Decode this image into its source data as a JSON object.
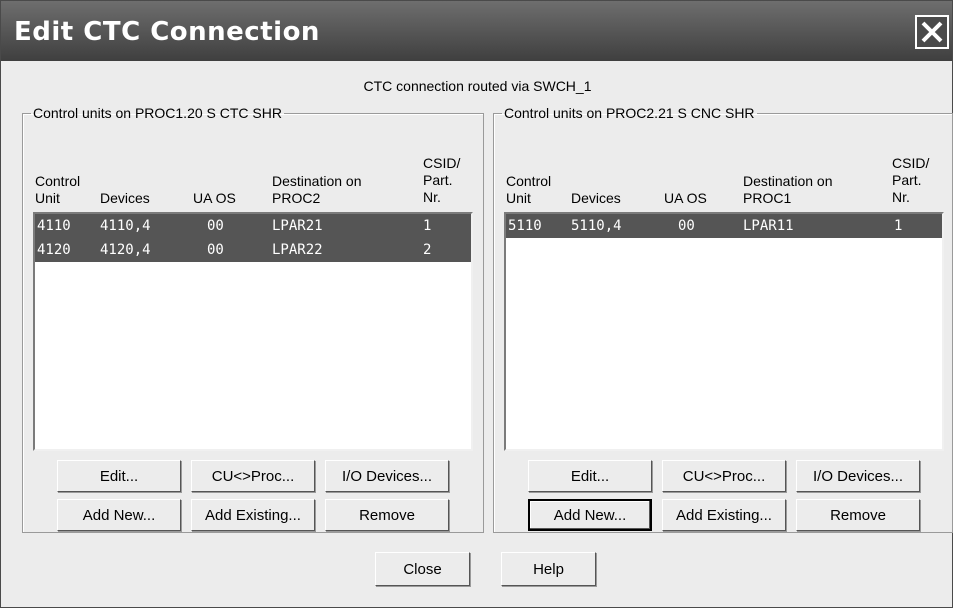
{
  "window": {
    "title": "Edit CTC Connection"
  },
  "route_text": "CTC connection routed via SWCH_1",
  "left_panel": {
    "legend": "Control units on PROC1.20 S CTC SHR",
    "headers": {
      "control_unit": [
        "Control",
        "Unit"
      ],
      "devices": "Devices",
      "ua_os": "UA OS",
      "destination": [
        "Destination on",
        "PROC2"
      ],
      "csid": [
        "CSID/",
        "Part.",
        "Nr."
      ]
    },
    "rows": [
      {
        "cu": "4110",
        "devices": "4110,4",
        "ua": "00",
        "dest": "LPAR21",
        "csid": "1"
      },
      {
        "cu": "4120",
        "devices": "4120,4",
        "ua": "00",
        "dest": "LPAR22",
        "csid": "2"
      }
    ],
    "buttons": {
      "edit": "Edit...",
      "cuproc": "CU<>Proc...",
      "io_devices": "I/O Devices...",
      "add_new": "Add New...",
      "add_existing": "Add Existing...",
      "remove": "Remove"
    }
  },
  "right_panel": {
    "legend": "Control units on PROC2.21 S CNC SHR",
    "headers": {
      "control_unit": [
        "Control",
        "Unit"
      ],
      "devices": "Devices",
      "ua_os": "UA OS",
      "destination": [
        "Destination on",
        "PROC1"
      ],
      "csid": [
        "CSID/",
        "Part.",
        "Nr."
      ]
    },
    "rows": [
      {
        "cu": "5110",
        "devices": "5110,4",
        "ua": "00",
        "dest": "LPAR11",
        "csid": "1"
      }
    ],
    "buttons": {
      "edit": "Edit...",
      "cuproc": "CU<>Proc...",
      "io_devices": "I/O Devices...",
      "add_new": "Add New...",
      "add_existing": "Add Existing...",
      "remove": "Remove"
    }
  },
  "footer": {
    "close": "Close",
    "help": "Help"
  },
  "colors": {
    "titlebar": "#4b4b4b",
    "selection": "#555555",
    "background": "#ececec"
  }
}
